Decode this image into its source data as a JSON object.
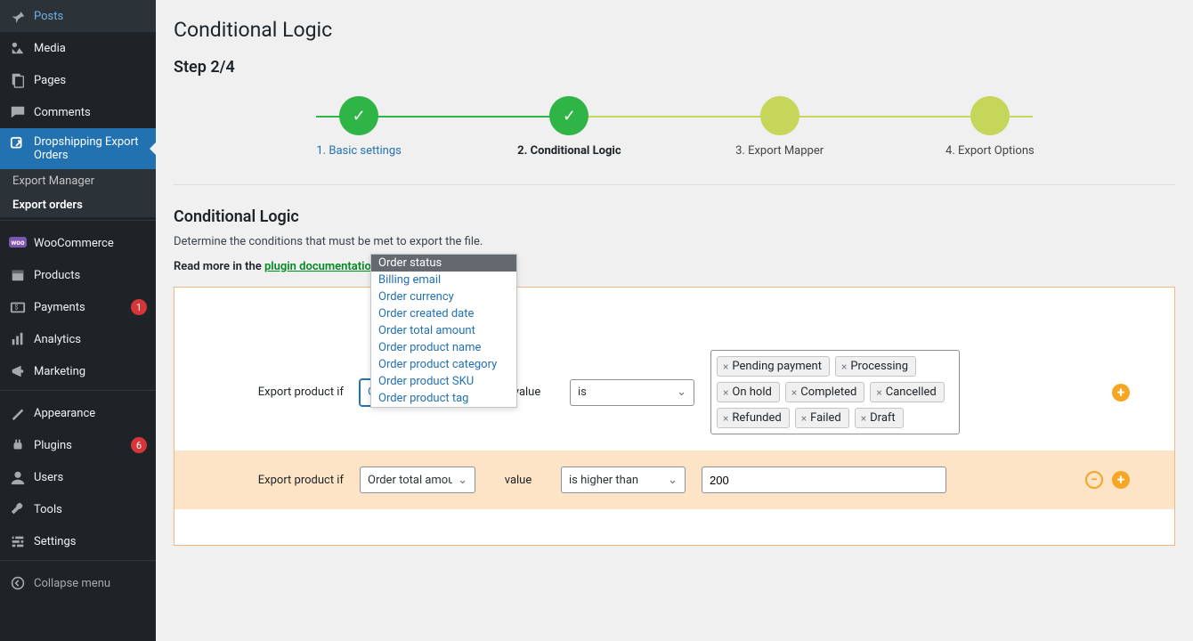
{
  "sidebar": {
    "items": [
      {
        "icon": "pin",
        "label": "Posts"
      },
      {
        "icon": "media",
        "label": "Media"
      },
      {
        "icon": "page",
        "label": "Pages"
      },
      {
        "icon": "comment",
        "label": "Comments"
      },
      {
        "icon": "export",
        "label": "Dropshipping Export Orders",
        "active": true,
        "sub": [
          {
            "label": "Export Manager"
          },
          {
            "label": "Export orders",
            "active": true
          }
        ]
      },
      {
        "sep": true
      },
      {
        "icon": "woo",
        "label": "WooCommerce"
      },
      {
        "icon": "box",
        "label": "Products"
      },
      {
        "icon": "payments",
        "label": "Payments",
        "badge": "1"
      },
      {
        "icon": "analytics",
        "label": "Analytics"
      },
      {
        "icon": "marketing",
        "label": "Marketing"
      },
      {
        "sep": true
      },
      {
        "icon": "appearance",
        "label": "Appearance"
      },
      {
        "icon": "plugins",
        "label": "Plugins",
        "badge": "6"
      },
      {
        "icon": "users",
        "label": "Users"
      },
      {
        "icon": "tools",
        "label": "Tools"
      },
      {
        "icon": "settings",
        "label": "Settings"
      },
      {
        "sep": true
      }
    ],
    "collapse": "Collapse menu"
  },
  "page": {
    "title": "Conditional Logic",
    "step_title": "Step 2/4"
  },
  "stepper": [
    {
      "num": "1.",
      "label": "Basic settings",
      "state": "done link"
    },
    {
      "num": "2.",
      "label": "Conditional Logic",
      "state": "done current"
    },
    {
      "num": "3.",
      "label": "Export Mapper",
      "state": "todo"
    },
    {
      "num": "4.",
      "label": "Export Options",
      "state": "todo"
    }
  ],
  "section": {
    "title": "Conditional Logic",
    "desc": "Determine the conditions that must be met to export the file.",
    "doc_prefix": "Read more in the ",
    "doc_link": "plugin documentation →"
  },
  "dropdown_options": [
    "Order status",
    "Billing email",
    "Order currency",
    "Order created date",
    "Order total amount",
    "Order product name",
    "Order product category",
    "Order product SKU",
    "Order product tag"
  ],
  "row1": {
    "label": "Export product if",
    "field": "Order status",
    "value_label": "value",
    "operator": "is",
    "tags": [
      "Pending payment",
      "Processing",
      "On hold",
      "Completed",
      "Cancelled",
      "Refunded",
      "Failed",
      "Draft"
    ]
  },
  "row2": {
    "label": "Export product if",
    "field": "Order total amount",
    "value_label": "value",
    "operator": "is higher than",
    "value": "200"
  }
}
